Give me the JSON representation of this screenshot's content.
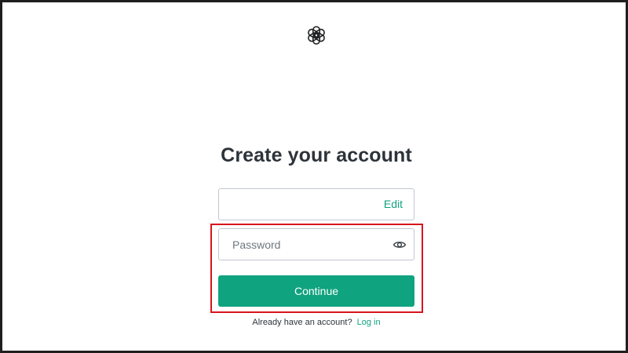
{
  "header": {
    "logo_icon": "openai-logo-icon"
  },
  "form": {
    "title": "Create your account",
    "email": {
      "value": "",
      "edit_label": "Edit"
    },
    "password": {
      "placeholder": "Password",
      "toggle_icon": "eye-icon"
    },
    "continue_label": "Continue"
  },
  "footer": {
    "prompt": "Already have an account?",
    "login_label": "Log in"
  },
  "colors": {
    "accent": "#10a37f",
    "highlight_box": "#d9141b",
    "text": "#2d333a",
    "input_border": "#c2c8d0"
  }
}
